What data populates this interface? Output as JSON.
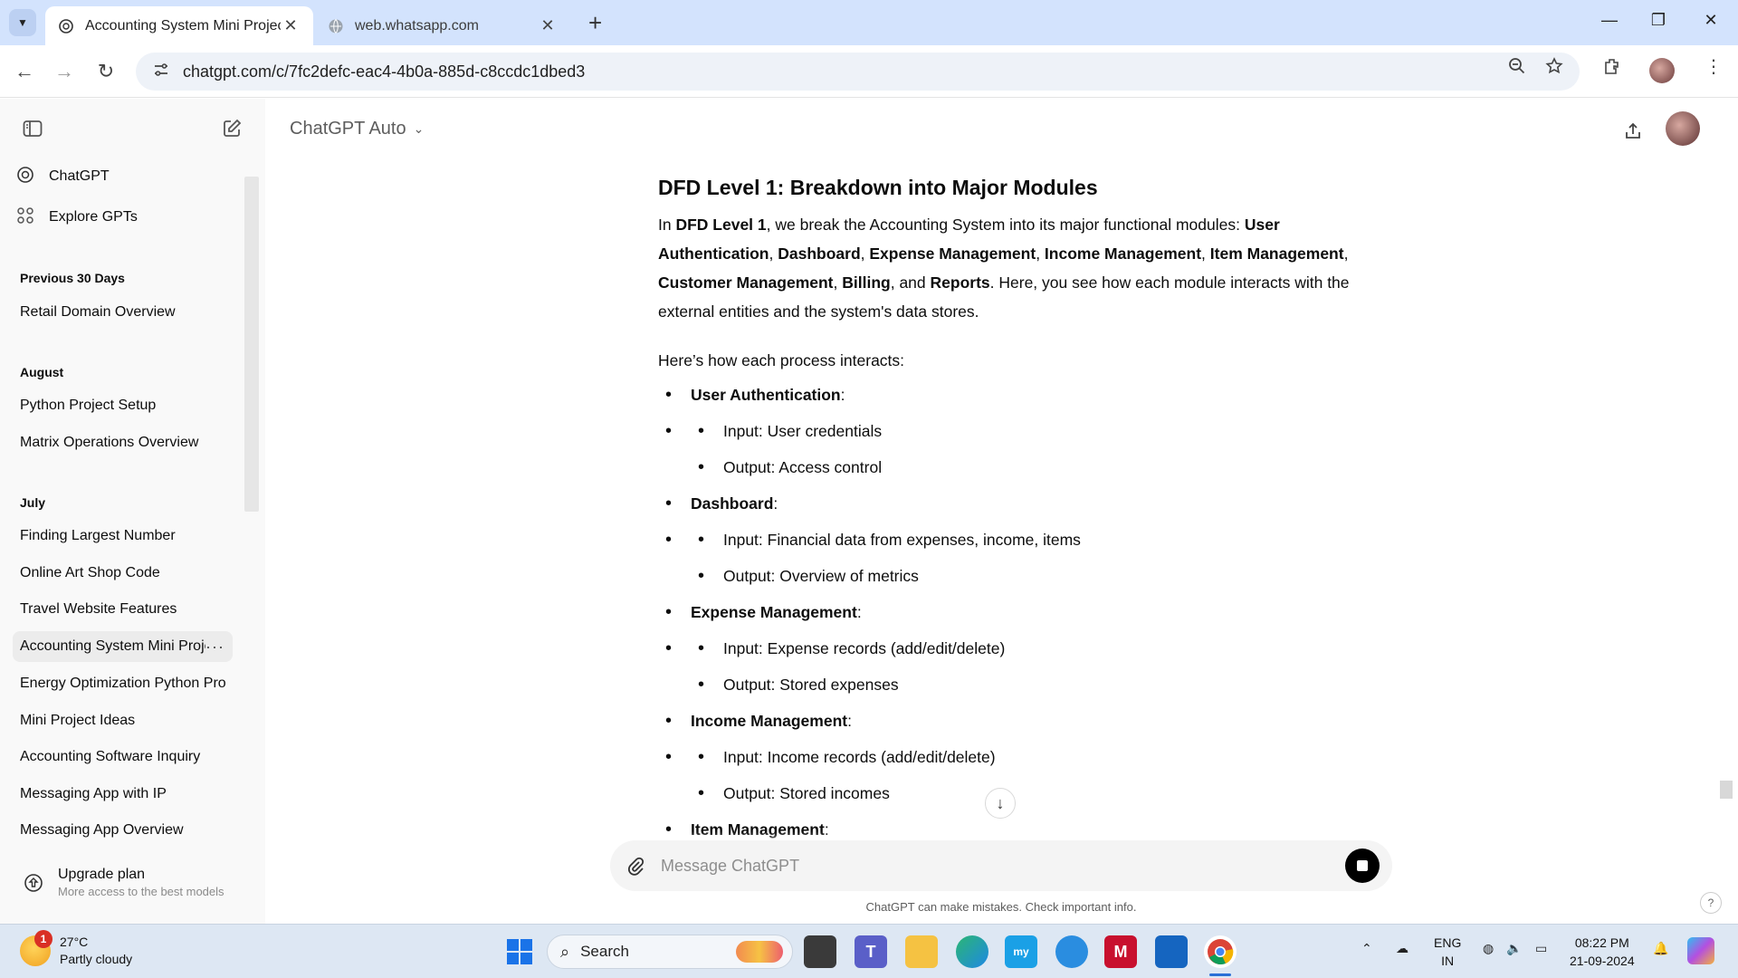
{
  "browser": {
    "tabs": [
      {
        "title": "Accounting System Mini Project",
        "active": true
      },
      {
        "title": "web.whatsapp.com",
        "active": false
      }
    ],
    "new_tab_label": "+",
    "url": "chatgpt.com/c/7fc2defc-eac4-4b0a-885d-c8ccdc1dbed3"
  },
  "sidebar": {
    "nav": [
      {
        "label": "ChatGPT",
        "icon": "chatgpt-logo-icon"
      },
      {
        "label": "Explore GPTs",
        "icon": "grid-icon"
      }
    ],
    "sections": [
      {
        "title": "Previous 30 Days",
        "items": [
          "Retail Domain Overview"
        ]
      },
      {
        "title": "August",
        "items": [
          "Python Project Setup",
          "Matrix Operations Overview"
        ]
      },
      {
        "title": "July",
        "items": [
          "Finding Largest Number",
          "Online Art Shop Code",
          "Travel Website Features",
          "Accounting System Mini Project",
          "Energy Optimization Python Pro",
          "Mini Project Ideas",
          "Accounting Software Inquiry",
          "Messaging App with IP",
          "Messaging App Overview"
        ]
      }
    ],
    "active_item": "Accounting System Mini Project",
    "more_label": "···",
    "upgrade": {
      "title": "Upgrade plan",
      "subtitle": "More access to the best models"
    }
  },
  "header": {
    "model": "ChatGPT Auto"
  },
  "message": {
    "heading": "DFD Level 1: Breakdown into Major Modules",
    "intro": {
      "t1": "In ",
      "b1": "DFD Level 1",
      "t2": ", we break the Accounting System into its major functional modules: ",
      "m1": "User Authentication",
      "m2": "Dashboard",
      "m3": "Expense Management",
      "m4": "Income Management",
      "m5": "Item Management",
      "m6": "Customer Management",
      "m7": "Billing",
      "m8": "Reports",
      "sep": ", ",
      "and": ", and ",
      "tail": ". Here, you see how each module interacts with the external entities and the system's data stores."
    },
    "lead": "Here’s how each process interacts:",
    "modules": [
      {
        "name": "User Authentication",
        "io": [
          "Input: User credentials",
          "Output: Access control"
        ]
      },
      {
        "name": "Dashboard",
        "io": [
          "Input: Financial data from expenses, income, items",
          "Output: Overview of metrics"
        ]
      },
      {
        "name": "Expense Management",
        "io": [
          "Input: Expense records (add/edit/delete)",
          "Output: Stored expenses"
        ]
      },
      {
        "name": "Income Management",
        "io": [
          "Input: Income records (add/edit/delete)",
          "Output: Stored incomes"
        ]
      },
      {
        "name": "Item Management",
        "io": []
      }
    ],
    "colon": ":"
  },
  "composer": {
    "placeholder": "Message ChatGPT",
    "disclaimer": "ChatGPT can make mistakes. Check important info.",
    "help": "?"
  },
  "taskbar": {
    "weather_temp": "27°C",
    "weather_desc": "Partly cloudy",
    "weather_badge": "1",
    "search_label": "Search",
    "lang_line1": "ENG",
    "lang_line2": "IN",
    "time": "08:22 PM",
    "date": "21-09-2024"
  },
  "colors": {
    "tab_strip": "#d3e3fd",
    "sidebar_bg": "#f9f9f9",
    "composer_bg": "#f4f4f4",
    "taskbar_bg": "#dde7f3"
  }
}
